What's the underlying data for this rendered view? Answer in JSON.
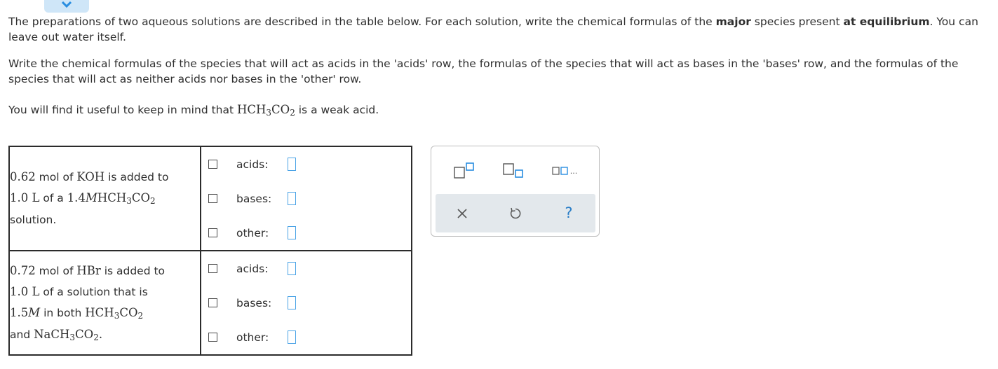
{
  "intro": {
    "p1_part1": "The preparations of two aqueous solutions are described in the table below. For each solution, write the chemical formulas of the ",
    "p1_bold1": "major",
    "p1_part2": " species present ",
    "p1_bold2": "at equilibrium",
    "p1_part3": ". You can leave out water itself.",
    "p2": "Write the chemical formulas of the species that will act as acids in the 'acids' row, the formulas of the species that will act as bases in the 'bases' row, and the formulas of the species that will act as neither acids nor bases in the 'other' row.",
    "p3_before": "You will find it useful to keep in mind that ",
    "p3_formula_main": "HCH",
    "p3_formula_sub1": "3",
    "p3_formula_mid": "CO",
    "p3_formula_sub2": "2",
    "p3_after": " is a weak acid."
  },
  "solutions": [
    {
      "amount": "0.62",
      "t1": " mol of ",
      "solute": "KOH",
      "t2": " is added to",
      "vol": "1.0 L",
      "t3": " of a ",
      "conc": "1.4",
      "molar": "M",
      "acid_main": "HCH",
      "acid_sub1": "3",
      "acid_mid": "CO",
      "acid_sub2": "2",
      "t4": "solution."
    },
    {
      "amount": "0.72",
      "t1": " mol of ",
      "solute": "HBr",
      "t2": " is added to",
      "vol": "1.0 L",
      "t3": " of a solution that is",
      "conc": "1.5",
      "molar": "M",
      "t_both": " in both ",
      "acid_main": "HCH",
      "acid_sub1": "3",
      "acid_mid": "CO",
      "acid_sub2": "2",
      "t_and": "and ",
      "salt_main": "NaCH",
      "salt_sub1": "3",
      "salt_mid": "CO",
      "salt_sub2": "2",
      "t_end": "."
    }
  ],
  "answer_labels": {
    "acids": "acids:",
    "bases": "bases:",
    "other": "other:"
  },
  "palette": {
    "icons": [
      "superscript-box-icon",
      "subscript-box-icon",
      "multiple-boxes-icon",
      "close-icon",
      "undo-icon",
      "help-icon"
    ],
    "ellipsis": "...",
    "help": "?",
    "accent": "#2a7ec7"
  }
}
